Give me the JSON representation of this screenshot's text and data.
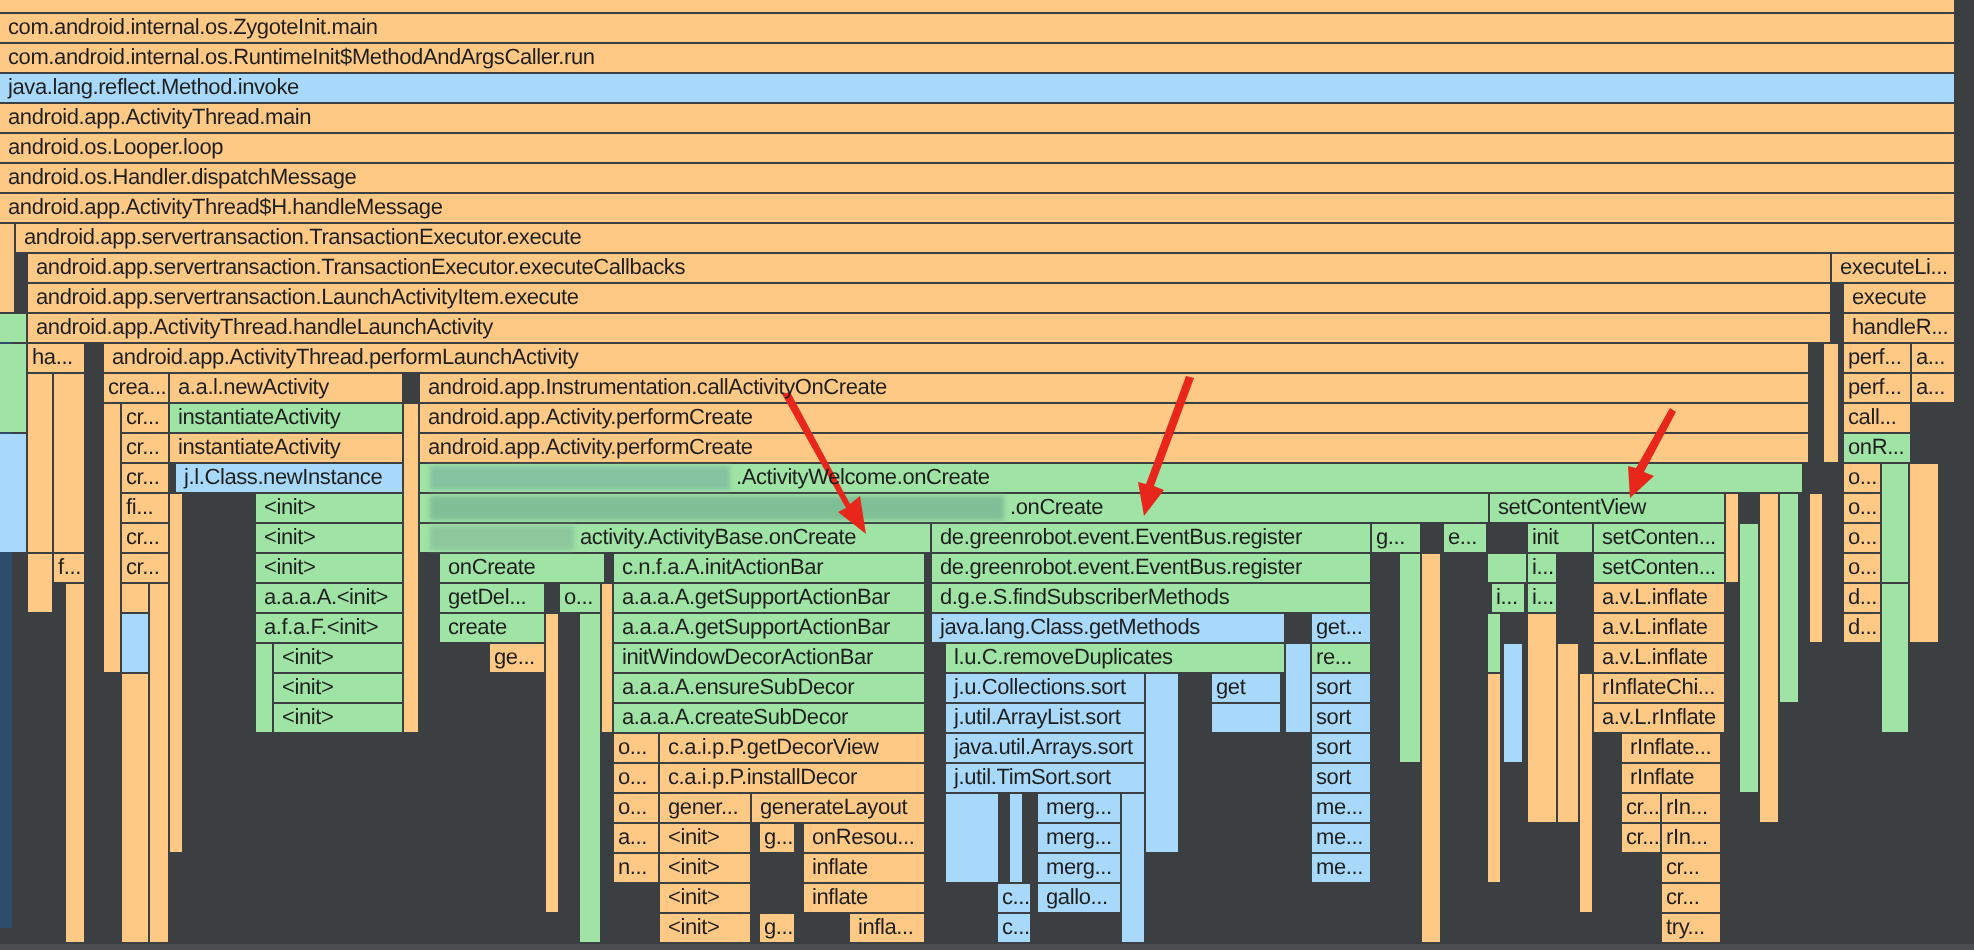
{
  "frames": [
    {
      "label": "com.android.internal.os.ZygoteInit.main",
      "color": "#fdc985"
    },
    {
      "label": "com.android.internal.os.RuntimeInit$MethodAndArgsCaller.run",
      "color": "#fdc985"
    },
    {
      "label": "java.lang.reflect.Method.invoke",
      "color": "#a9d9fa"
    },
    {
      "label": "android.app.ActivityThread.main",
      "color": "#fdc985"
    },
    {
      "label": "android.os.Looper.loop",
      "color": "#fdc985"
    },
    {
      "label": "android.os.Handler.dispatchMessage",
      "color": "#fdc985"
    },
    {
      "label": "android.app.ActivityThread$H.handleMessage",
      "color": "#fdc985"
    },
    {
      "label": "android.app.servertransaction.TransactionExecutor.execute",
      "color": "#fdc985"
    },
    {
      "label": "android.app.servertransaction.TransactionExecutor.executeCallbacks",
      "color": "#fdc985"
    },
    {
      "label": "executeLi...",
      "color": "#fdc985"
    },
    {
      "label": "android.app.servertransaction.LaunchActivityItem.execute",
      "color": "#fdc985"
    },
    {
      "label": "execute",
      "color": "#fdc985"
    },
    {
      "label": "android.app.ActivityThread.handleLaunchActivity",
      "color": "#fdc985"
    },
    {
      "label": "handleR...",
      "color": "#fdc985"
    },
    {
      "label": "ha...",
      "color": "#fdc985"
    },
    {
      "label": "android.app.ActivityThread.performLaunchActivity",
      "color": "#fdc985"
    },
    {
      "label": "perf...",
      "color": "#fdc985"
    },
    {
      "label": "a...",
      "color": "#fdc985"
    },
    {
      "label": "crea...",
      "color": "#fdc985"
    },
    {
      "label": "a.a.l.newActivity",
      "color": "#fdc985"
    },
    {
      "label": "android.app.Instrumentation.callActivityOnCreate",
      "color": "#fdc985"
    },
    {
      "label": "perf...",
      "color": "#fdc985"
    },
    {
      "label": "a...",
      "color": "#fdc985"
    },
    {
      "label": "cr...",
      "color": "#fdc985"
    },
    {
      "label": "instantiateActivity",
      "color": "#9fe3a5"
    },
    {
      "label": "android.app.Activity.performCreate",
      "color": "#fdc985"
    },
    {
      "label": "call...",
      "color": "#fdc985"
    },
    {
      "label": "cr...",
      "color": "#fdc985"
    },
    {
      "label": "instantiateActivity",
      "color": "#fdc985"
    },
    {
      "label": "android.app.Activity.performCreate",
      "color": "#fdc985"
    },
    {
      "label": "onR...",
      "color": "#9fe3a5"
    },
    {
      "label": "cr...",
      "color": "#fdc985"
    },
    {
      "label": "j.l.Class.newInstance",
      "color": "#a9d9fa"
    },
    {
      "label": ".ActivityWelcome.onCreate",
      "color": "#9fe3a5"
    },
    {
      "label": "o...",
      "color": "#fdc985"
    },
    {
      "label": "fi...",
      "color": "#fdc985"
    },
    {
      "label": "<init>",
      "color": "#9fe3a5"
    },
    {
      "label": ".onCreate",
      "color": "#9fe3a5"
    },
    {
      "label": "setContentView",
      "color": "#9fe3a5"
    },
    {
      "label": "o...",
      "color": "#fdc985"
    },
    {
      "label": "cr...",
      "color": "#fdc985"
    },
    {
      "label": "<init>",
      "color": "#9fe3a5"
    },
    {
      "label": "activity.ActivityBase.onCreate",
      "color": "#9fe3a5"
    },
    {
      "label": "de.greenrobot.event.EventBus.register",
      "color": "#9fe3a5"
    },
    {
      "label": "g...",
      "color": "#9fe3a5"
    },
    {
      "label": "e...",
      "color": "#9fe3a5"
    },
    {
      "label": "init",
      "color": "#9fe3a5"
    },
    {
      "label": "setConten...",
      "color": "#9fe3a5"
    },
    {
      "label": "o...",
      "color": "#fdc985"
    },
    {
      "label": "f...",
      "color": "#fdc985"
    },
    {
      "label": "cr...",
      "color": "#fdc985"
    },
    {
      "label": "<init>",
      "color": "#9fe3a5"
    },
    {
      "label": "onCreate",
      "color": "#9fe3a5"
    },
    {
      "label": "c.n.f.a.A.initActionBar",
      "color": "#9fe3a5"
    },
    {
      "label": "de.greenrobot.event.EventBus.register",
      "color": "#9fe3a5"
    },
    {
      "label": "i...",
      "color": "#9fe3a5"
    },
    {
      "label": "setConten...",
      "color": "#9fe3a5"
    },
    {
      "label": "o...",
      "color": "#fdc985"
    },
    {
      "label": "a.a.a.A.<init>",
      "color": "#9fe3a5"
    },
    {
      "label": "getDel...",
      "color": "#9fe3a5"
    },
    {
      "label": "o...",
      "color": "#9fe3a5"
    },
    {
      "label": "a.a.a.A.getSupportActionBar",
      "color": "#9fe3a5"
    },
    {
      "label": "d.g.e.S.findSubscriberMethods",
      "color": "#9fe3a5"
    },
    {
      "label": "i...",
      "color": "#9fe3a5"
    },
    {
      "label": "i...",
      "color": "#9fe3a5"
    },
    {
      "label": "a.v.L.inflate",
      "color": "#fdc985"
    },
    {
      "label": "d...",
      "color": "#fdc985"
    },
    {
      "label": "a.f.a.F.<init>",
      "color": "#9fe3a5"
    },
    {
      "label": "create",
      "color": "#9fe3a5"
    },
    {
      "label": "a.a.a.A.getSupportActionBar",
      "color": "#9fe3a5"
    },
    {
      "label": "java.lang.Class.getMethods",
      "color": "#a9d9fa"
    },
    {
      "label": "get...",
      "color": "#a9d9fa"
    },
    {
      "label": "a.v.L.inflate",
      "color": "#fdc985"
    },
    {
      "label": "d...",
      "color": "#fdc985"
    },
    {
      "label": "<init>",
      "color": "#9fe3a5"
    },
    {
      "label": "ge...",
      "color": "#fdc985"
    },
    {
      "label": "initWindowDecorActionBar",
      "color": "#9fe3a5"
    },
    {
      "label": "l.u.C.removeDuplicates",
      "color": "#9fe3a5"
    },
    {
      "label": "re...",
      "color": "#9fe3a5"
    },
    {
      "label": "a.v.L.inflate",
      "color": "#fdc985"
    },
    {
      "label": "<init>",
      "color": "#9fe3a5"
    },
    {
      "label": "a.a.a.A.ensureSubDecor",
      "color": "#9fe3a5"
    },
    {
      "label": "j.u.Collections.sort",
      "color": "#a9d9fa"
    },
    {
      "label": "get",
      "color": "#a9d9fa"
    },
    {
      "label": "sort",
      "color": "#a9d9fa"
    },
    {
      "label": "rInflateChi...",
      "color": "#fdc985"
    },
    {
      "label": "<init>",
      "color": "#9fe3a5"
    },
    {
      "label": "a.a.a.A.createSubDecor",
      "color": "#9fe3a5"
    },
    {
      "label": "j.util.ArrayList.sort",
      "color": "#a9d9fa"
    },
    {
      "label": "sort",
      "color": "#a9d9fa"
    },
    {
      "label": "a.v.L.rInflate",
      "color": "#fdc985"
    },
    {
      "label": "o...",
      "color": "#fdc985"
    },
    {
      "label": "c.a.i.p.P.getDecorView",
      "color": "#fdc985"
    },
    {
      "label": "java.util.Arrays.sort",
      "color": "#a9d9fa"
    },
    {
      "label": "sort",
      "color": "#a9d9fa"
    },
    {
      "label": "rInflate...",
      "color": "#fdc985"
    },
    {
      "label": "o...",
      "color": "#fdc985"
    },
    {
      "label": "c.a.i.p.P.installDecor",
      "color": "#fdc985"
    },
    {
      "label": "j.util.TimSort.sort",
      "color": "#a9d9fa"
    },
    {
      "label": "sort",
      "color": "#a9d9fa"
    },
    {
      "label": "rInflate",
      "color": "#fdc985"
    },
    {
      "label": "o...",
      "color": "#fdc985"
    },
    {
      "label": "gener...",
      "color": "#fdc985"
    },
    {
      "label": "generateLayout",
      "color": "#fdc985"
    },
    {
      "label": "merg...",
      "color": "#a9d9fa"
    },
    {
      "label": "me...",
      "color": "#a9d9fa"
    },
    {
      "label": "cr...",
      "color": "#fdc985"
    },
    {
      "label": "rIn...",
      "color": "#fdc985"
    },
    {
      "label": "a...",
      "color": "#fdc985"
    },
    {
      "label": "<init>",
      "color": "#fdc985"
    },
    {
      "label": "g...",
      "color": "#fdc985"
    },
    {
      "label": "onResou...",
      "color": "#fdc985"
    },
    {
      "label": "merg...",
      "color": "#a9d9fa"
    },
    {
      "label": "me...",
      "color": "#a9d9fa"
    },
    {
      "label": "cr...",
      "color": "#fdc985"
    },
    {
      "label": "rIn...",
      "color": "#fdc985"
    },
    {
      "label": "n...",
      "color": "#fdc985"
    },
    {
      "label": "<init>",
      "color": "#fdc985"
    },
    {
      "label": "inflate",
      "color": "#fdc985"
    },
    {
      "label": "merg...",
      "color": "#a9d9fa"
    },
    {
      "label": "me...",
      "color": "#a9d9fa"
    },
    {
      "label": "cr...",
      "color": "#fdc985"
    },
    {
      "label": "<init>",
      "color": "#fdc985"
    },
    {
      "label": "inflate",
      "color": "#fdc985"
    },
    {
      "label": "c...",
      "color": "#a9d9fa"
    },
    {
      "label": "gallo...",
      "color": "#a9d9fa"
    },
    {
      "label": "cr...",
      "color": "#fdc985"
    },
    {
      "label": "<init>",
      "color": "#fdc985"
    },
    {
      "label": "g...",
      "color": "#fdc985"
    },
    {
      "label": "infla...",
      "color": "#fdc985"
    },
    {
      "label": "c...",
      "color": "#a9d9fa"
    },
    {
      "label": "try...",
      "color": "#fdc985"
    }
  ]
}
